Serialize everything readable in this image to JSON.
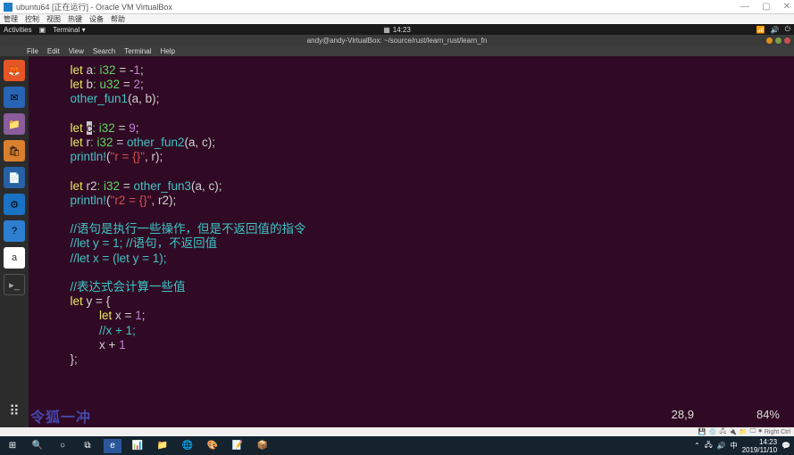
{
  "vbox": {
    "title": "ubuntu64 [正在运行] - Oracle VM VirtualBox",
    "menu": [
      "管理",
      "控制",
      "视图",
      "热键",
      "设备",
      "帮助"
    ],
    "statusright": "Right Ctrl"
  },
  "gnome": {
    "activities": "Activities",
    "terminal": "Terminal ▾",
    "time": "14:23"
  },
  "term": {
    "title": "andy@andy-VirtualBox: ~/source/rust/learn_rust/learn_fn",
    "menu": [
      "File",
      "Edit",
      "View",
      "Search",
      "Terminal",
      "Help"
    ]
  },
  "code": {
    "l1": {
      "kw": "let",
      "id": " a",
      "type": ": i32 ",
      "eq": "= ",
      "op": "-",
      "num": "1",
      "end": ";"
    },
    "l2": {
      "kw": "let",
      "id": " b",
      "type": ": u32 ",
      "eq": "= ",
      "num": "2",
      "end": ";"
    },
    "l3": {
      "fn": "other_fun1",
      "args": "(a, b);"
    },
    "l4": {
      "kw": "let",
      "sp": " ",
      "cur": "c",
      "type": ": i32 ",
      "eq": "= ",
      "num": "9",
      "end": ";"
    },
    "l5": {
      "kw": "let",
      "id": " r",
      "type": ": i32 ",
      "eq": "= ",
      "fn": "other_fun2",
      "args": "(a, c);"
    },
    "l6": {
      "mac": "println!",
      "op": "(",
      "str": "\"r = {}\"",
      "args": ", r);"
    },
    "l7": {
      "kw": "let",
      "id": " r2",
      "type": ": i32 ",
      "eq": "= ",
      "fn": "other_fun3",
      "args": "(a, c);"
    },
    "l8": {
      "mac": "println!",
      "op": "(",
      "str": "\"r2 = {}\"",
      "args": ", r2);"
    },
    "l9": {
      "cmt": "//语句是执行一些操作，但是不返回值的指令"
    },
    "l10": {
      "cmt": "//let y = 1; //语句，不返回值"
    },
    "l11": {
      "cmt": "//let x = (let y = 1);"
    },
    "l12": {
      "cmt": "//表达式会计算一些值"
    },
    "l13": {
      "kw": "let",
      "id": " y ",
      "eq": "= ",
      "op": "{"
    },
    "l14": {
      "kw": "let",
      "id": " x ",
      "eq": "= ",
      "num": "1",
      "end": ";"
    },
    "l15": {
      "cmt": "//x + 1;"
    },
    "l16": {
      "id": "x ",
      "op": "+ ",
      "num": "1"
    },
    "l17": {
      "op": "};"
    }
  },
  "vim": {
    "pos": "28,9",
    "pct": "84%"
  },
  "watermark": "令狐一冲",
  "win": {
    "time": "14:23",
    "date": "2019/11/10",
    "ime": "中"
  }
}
